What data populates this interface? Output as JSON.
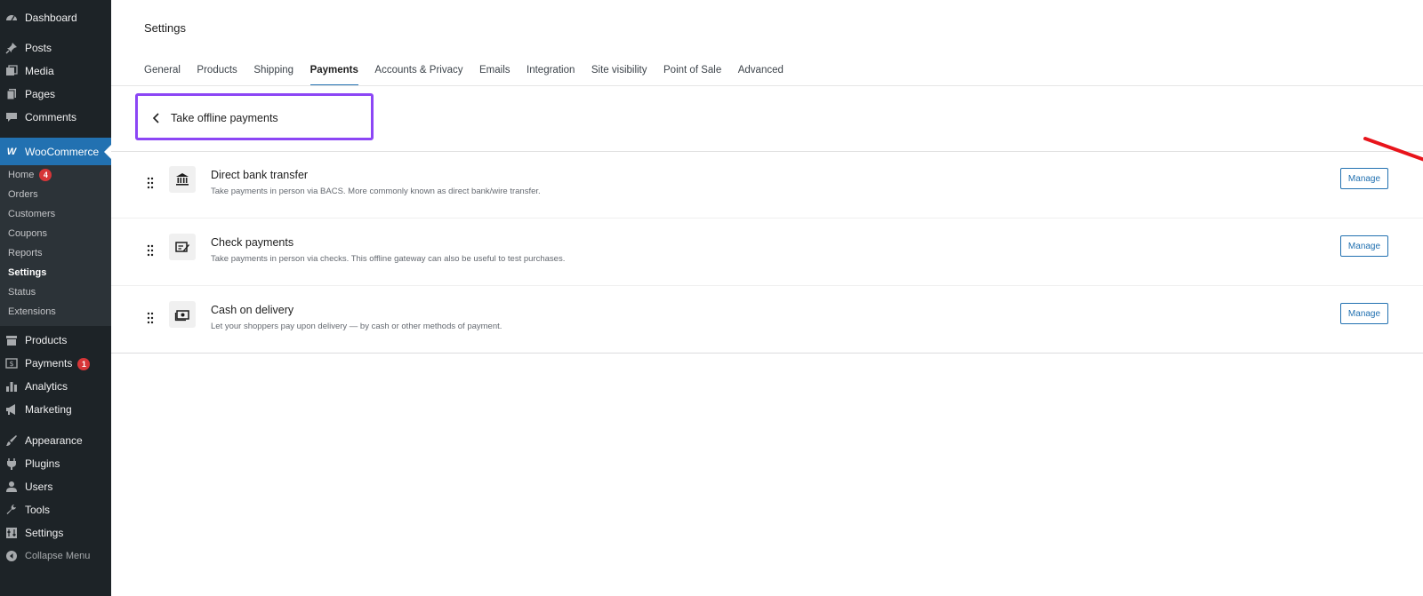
{
  "sidebar": {
    "items": [
      {
        "label": "Dashboard",
        "icon": "dashboard-icon"
      },
      {
        "label": "Posts",
        "icon": "pin-icon"
      },
      {
        "label": "Media",
        "icon": "media-icon"
      },
      {
        "label": "Pages",
        "icon": "pages-icon"
      },
      {
        "label": "Comments",
        "icon": "comments-icon"
      }
    ],
    "woocommerce": {
      "label": "WooCommerce",
      "icon": "woo-icon"
    },
    "submenu": [
      {
        "label": "Home",
        "badge": "4"
      },
      {
        "label": "Orders"
      },
      {
        "label": "Customers"
      },
      {
        "label": "Coupons"
      },
      {
        "label": "Reports"
      },
      {
        "label": "Settings",
        "current": true
      },
      {
        "label": "Status"
      },
      {
        "label": "Extensions"
      }
    ],
    "items2": [
      {
        "label": "Products",
        "icon": "archive-icon"
      },
      {
        "label": "Payments",
        "icon": "payments-icon",
        "badge": "1"
      },
      {
        "label": "Analytics",
        "icon": "analytics-icon"
      },
      {
        "label": "Marketing",
        "icon": "megaphone-icon"
      }
    ],
    "items3": [
      {
        "label": "Appearance",
        "icon": "brush-icon"
      },
      {
        "label": "Plugins",
        "icon": "plugin-icon"
      },
      {
        "label": "Users",
        "icon": "users-icon"
      },
      {
        "label": "Tools",
        "icon": "wrench-icon"
      },
      {
        "label": "Settings",
        "icon": "settings-icon"
      }
    ],
    "collapse_label": "Collapse Menu"
  },
  "page": {
    "title": "Settings",
    "tabs": [
      "General",
      "Products",
      "Shipping",
      "Payments",
      "Accounts & Privacy",
      "Emails",
      "Integration",
      "Site visibility",
      "Point of Sale",
      "Advanced"
    ],
    "active_tab": "Payments",
    "section_title": "Take offline payments"
  },
  "gateways": [
    {
      "title": "Direct bank transfer",
      "description": "Take payments in person via BACS. More commonly known as direct bank/wire transfer.",
      "icon": "bank-icon",
      "button": "Manage"
    },
    {
      "title": "Check payments",
      "description": "Take payments in person via checks. This offline gateway can also be useful to test purchases.",
      "icon": "check-icon",
      "button": "Manage"
    },
    {
      "title": "Cash on delivery",
      "description": "Let your shoppers pay upon delivery — by cash or other methods of payment.",
      "icon": "cash-icon",
      "button": "Manage"
    }
  ],
  "colors": {
    "sidebar_bg": "#1d2327",
    "accent": "#2271b1",
    "highlight_box": "#8c46f5",
    "annotation_arrow": "#e8141b"
  }
}
